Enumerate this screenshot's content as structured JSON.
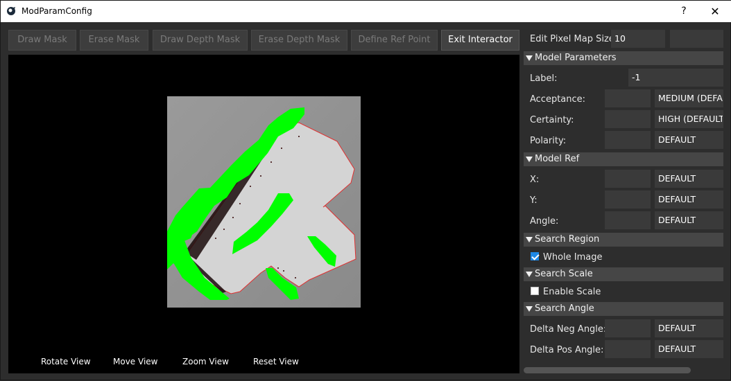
{
  "window": {
    "title": "ModParamConfig",
    "help": "?",
    "close": "✕"
  },
  "toolbar": {
    "draw_mask": "Draw Mask",
    "erase_mask": "Erase Mask",
    "draw_depth_mask": "Draw Depth Mask",
    "erase_depth_mask": "Erase Depth Mask",
    "define_ref_point": "Define Ref Point",
    "exit_interactor": "Exit Interactor"
  },
  "view_controls": {
    "rotate": "Rotate View",
    "move": "Move View",
    "zoom": "Zoom View",
    "reset": "Reset View"
  },
  "panel": {
    "pixel_map": {
      "label": "Edit Pixel Map Size:",
      "value": "10"
    },
    "model_parameters": {
      "header": "Model Parameters",
      "label": {
        "label": "Label:",
        "value": "-1"
      },
      "acceptance": {
        "label": "Acceptance:",
        "value": "",
        "option": "MEDIUM (DEFAULT)"
      },
      "certainty": {
        "label": "Certainty:",
        "value": "",
        "option": "HIGH (DEFAULT)"
      },
      "polarity": {
        "label": "Polarity:",
        "value": "",
        "option": "DEFAULT"
      }
    },
    "model_ref": {
      "header": "Model Ref",
      "x": {
        "label": "X:",
        "option": "DEFAULT"
      },
      "y": {
        "label": "Y:",
        "option": "DEFAULT"
      },
      "angle": {
        "label": "Angle:",
        "option": "DEFAULT"
      }
    },
    "search_region": {
      "header": "Search Region",
      "whole_image": "Whole Image",
      "whole_image_checked": true
    },
    "search_scale": {
      "header": "Search Scale",
      "enable_scale": "Enable Scale",
      "enable_scale_checked": false
    },
    "search_angle": {
      "header": "Search Angle",
      "delta_neg": {
        "label": "Delta Neg Angle:",
        "option": "DEFAULT"
      },
      "delta_pos": {
        "label": "Delta Pos Angle:",
        "option": "DEFAULT"
      }
    }
  },
  "colors": {
    "mask": "#00ff00",
    "edge": "#ff2020",
    "accent": "#1e88e5"
  }
}
